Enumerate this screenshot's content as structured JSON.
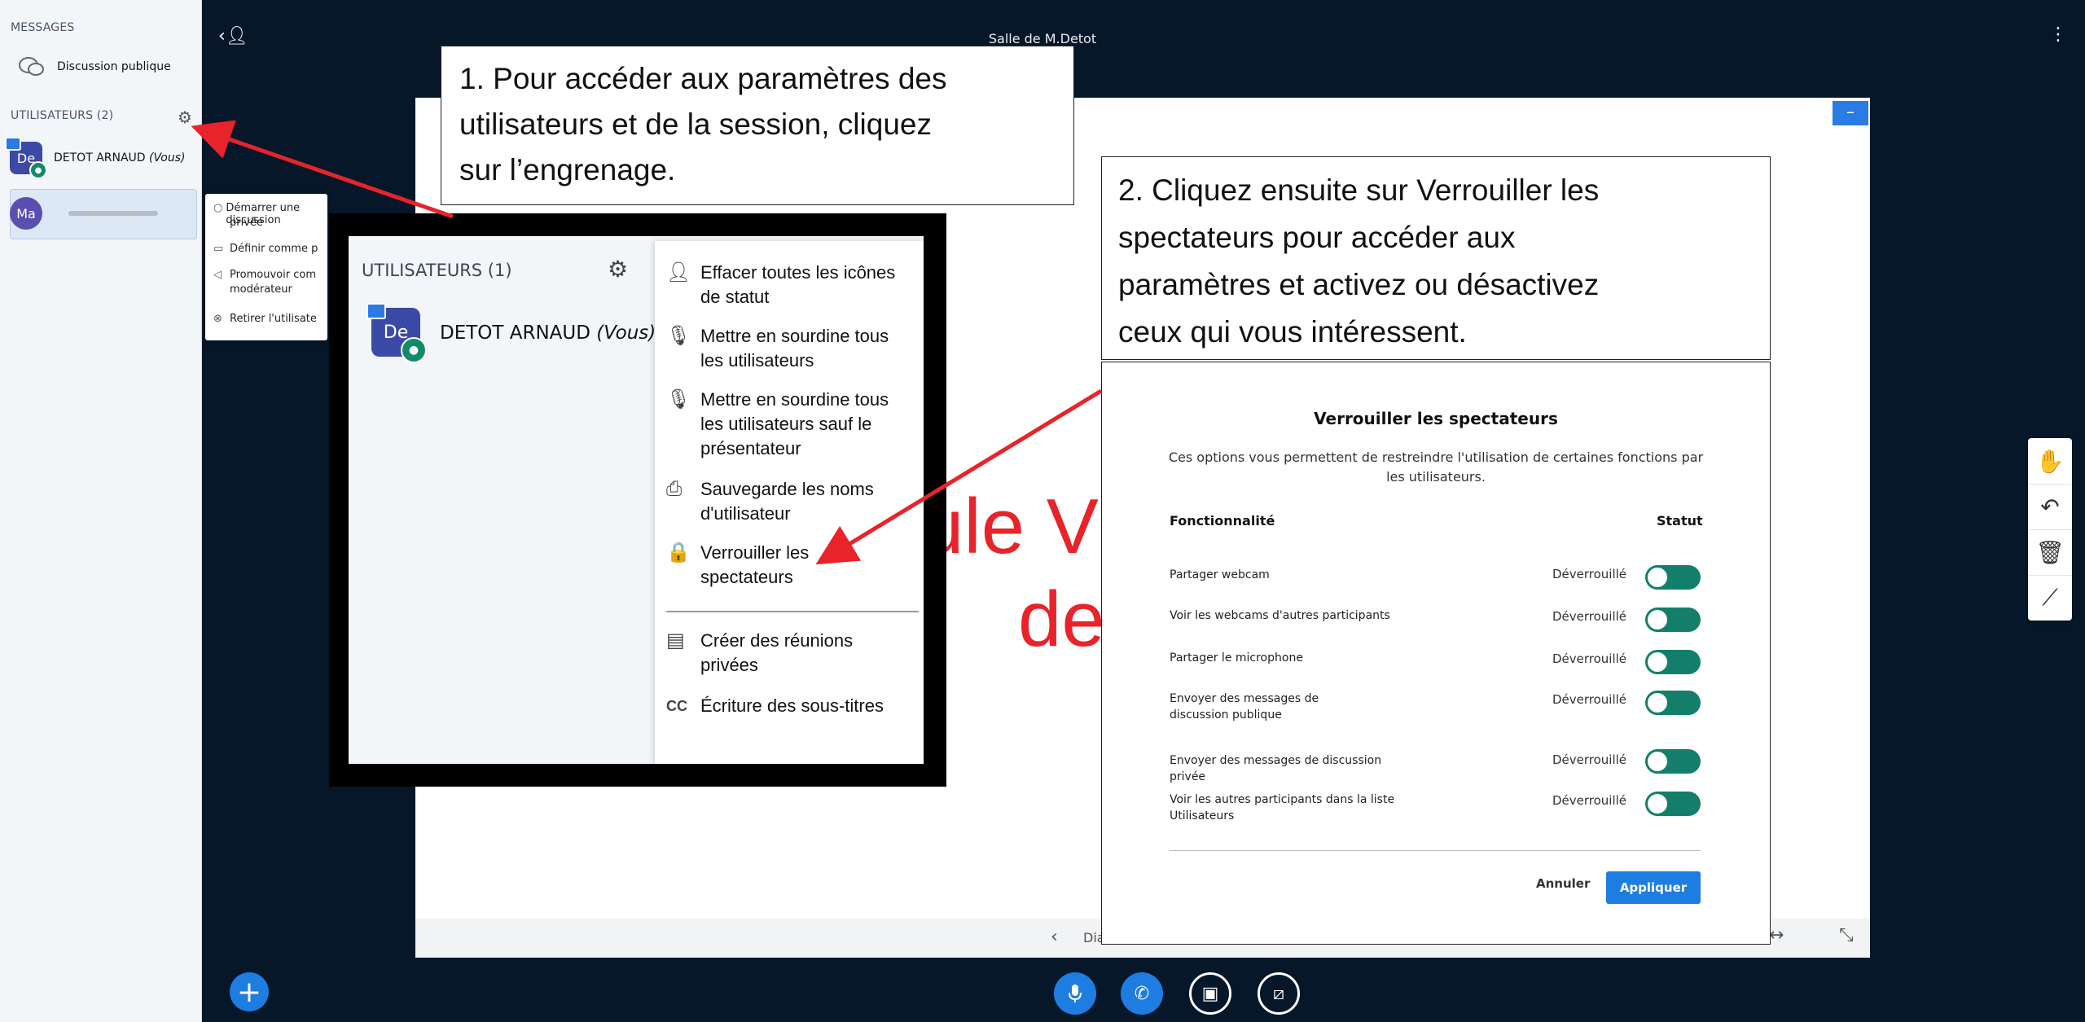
{
  "room_title": "Salle de M.Detot",
  "sidebar": {
    "messages_title": "MESSAGES",
    "public_chat_label": "Discussion publique",
    "users_title": "UTILISATEURS (2)",
    "users": [
      {
        "initials": "De",
        "name": "DETOT ARNAUD",
        "you_label": "(Vous)"
      },
      {
        "initials": "Ma",
        "name": ""
      }
    ],
    "context_menu": [
      "Démarrer une discussion",
      "privée",
      "Définir comme p",
      "Promouvoir com",
      "modérateur",
      "Retirer l'utilisate"
    ]
  },
  "callout1": {
    "lines": [
      "1. Pour accéder aux paramètres des",
      "utilisateurs et de la session, cliquez",
      "sur l’engrenage."
    ]
  },
  "callout2": {
    "lines": [
      "2. Cliquez ensuite sur Verrouiller les",
      "spectateurs pour accéder aux",
      "paramètres et activez ou désactivez",
      "ceux qui vous intéressent."
    ]
  },
  "zoom": {
    "users_title": "UTILISATEURS (1)",
    "user_initials": "De",
    "user_name": "DETOT ARNAUD",
    "you_label": "(Vous)",
    "menu": [
      {
        "icon": "clear-status-icon",
        "lines": [
          "Effacer toutes les icônes",
          "de statut"
        ]
      },
      {
        "icon": "mute-icon",
        "lines": [
          "Mettre en sourdine tous",
          "les utilisateurs"
        ]
      },
      {
        "icon": "mute-icon",
        "lines": [
          "Mettre en sourdine tous",
          "les utilisateurs sauf le",
          "présentateur"
        ]
      },
      {
        "icon": "download-icon",
        "lines": [
          "Sauvegarde les noms",
          "d'utilisateur"
        ]
      },
      {
        "icon": "lock-icon",
        "lines": [
          "Verrouiller les",
          "spectateurs"
        ]
      },
      {
        "icon": "breakout-icon",
        "lines": [
          "Créer des réunions",
          "privées"
        ]
      },
      {
        "icon": "cc-icon",
        "lines": [
          "Écriture des sous-titres"
        ]
      }
    ]
  },
  "slide": {
    "word1": "ule V",
    "word2": "de",
    "nav_label": "Dia"
  },
  "dialog": {
    "title": "Verrouiller les spectateurs",
    "desc": "Ces options vous permettent de restreindre l'utilisation de certaines fonctions par les utilisateurs.",
    "col_feature": "Fonctionnalité",
    "col_status": "Statut",
    "rows": [
      {
        "label": "Partager webcam",
        "status": "Déverrouillé"
      },
      {
        "label": "Voir les webcams d'autres participants",
        "status": "Déverrouillé"
      },
      {
        "label": "Partager le microphone",
        "status": "Déverrouillé"
      },
      {
        "label": "Envoyer des messages de discussion publique",
        "status": "Déverrouillé"
      },
      {
        "label": "Envoyer des messages de discussion privée",
        "status": "Déverrouillé"
      },
      {
        "label": "Voir les autres participants dans la liste Utilisateurs",
        "status": "Déverrouillé"
      }
    ],
    "cancel": "Annuler",
    "apply": "Appliquer"
  },
  "colors": {
    "accent": "#1E7DE0",
    "toggle": "#137F6A",
    "arrow": "#E8232A",
    "bg": "#06172A"
  }
}
